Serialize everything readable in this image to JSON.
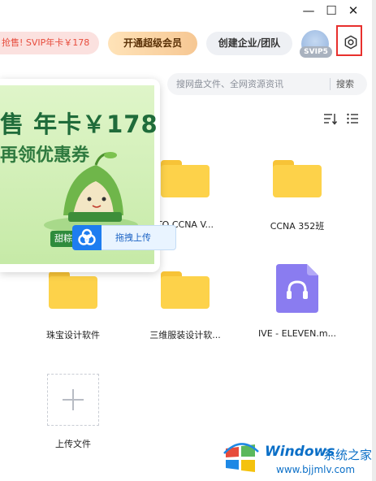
{
  "window": {
    "minimize_glyph": "—",
    "maximize_glyph": "☐",
    "close_glyph": "✕"
  },
  "header": {
    "promo_text": "抢售! SVIP年卡￥178",
    "vip_button": "开通超级会员",
    "enterprise_button": "创建企业/团队",
    "badge": "SVIP5",
    "settings_icon": "gear-icon",
    "highlight_color": "#e8302d"
  },
  "search": {
    "placeholder": "搜网盘文件、全网资源资讯",
    "button": "搜索"
  },
  "toolbar": {
    "sort_icon": "sort-icon",
    "view_icon": "list-view-icon"
  },
  "banner": {
    "title": "售 年卡￥178",
    "subtitle": "再领优惠券",
    "chip": "甜粽"
  },
  "drag_upload": {
    "label": "拖拽上传"
  },
  "files": [
    {
      "name": "TO CCNA V...",
      "type": "folder"
    },
    {
      "name": "CCNA 352班",
      "type": "folder"
    },
    {
      "name": "珠宝设计软件",
      "type": "folder"
    },
    {
      "name": "三维服装设计软...",
      "type": "folder"
    },
    {
      "name": "IVE - ELEVEN.m...",
      "type": "audio"
    },
    {
      "name": "上传文件",
      "type": "upload"
    }
  ],
  "watermark": {
    "brand": "Windows",
    "cn": "系统之家",
    "url": "www.bjjmlv.com"
  }
}
